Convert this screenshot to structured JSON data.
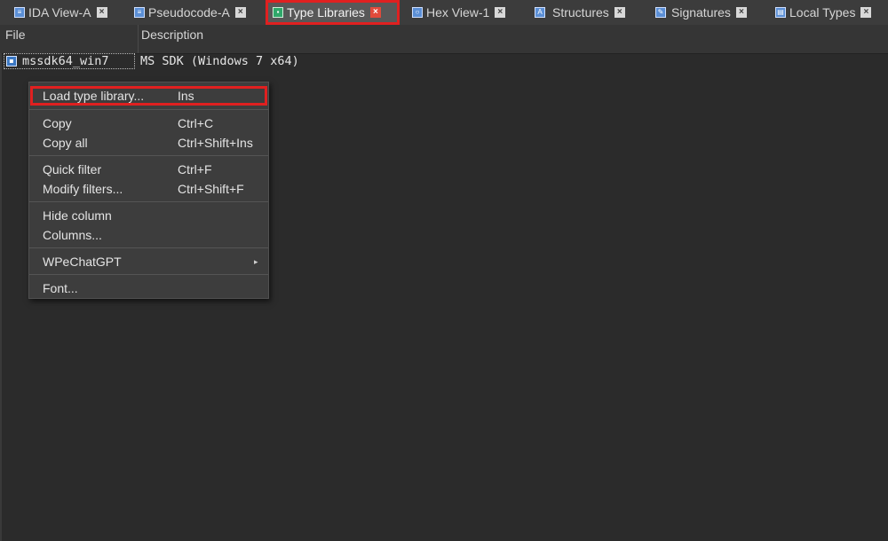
{
  "tabs": [
    {
      "label": "IDA View-A",
      "icon": "ida-view-icon"
    },
    {
      "label": "Pseudocode-A",
      "icon": "pseudocode-icon"
    },
    {
      "label": "Type Libraries",
      "icon": "type-libraries-icon",
      "active": true
    },
    {
      "label": "Hex View-1",
      "icon": "hex-view-icon"
    },
    {
      "label": "Structures",
      "icon": "structures-icon"
    },
    {
      "label": "Signatures",
      "icon": "signatures-icon"
    },
    {
      "label": "Local Types",
      "icon": "local-types-icon"
    }
  ],
  "columns": {
    "file": "File",
    "description": "Description"
  },
  "rows": [
    {
      "file": "mssdk64_win7",
      "description": "MS SDK (Windows 7 x64)"
    }
  ],
  "context_menu": {
    "items": [
      {
        "label": "Load type library...",
        "shortcut": "Ins"
      },
      {
        "label": "Copy",
        "shortcut": "Ctrl+C"
      },
      {
        "label": "Copy all",
        "shortcut": "Ctrl+Shift+Ins"
      },
      {
        "label": "Quick filter",
        "shortcut": "Ctrl+F"
      },
      {
        "label": "Modify filters...",
        "shortcut": "Ctrl+Shift+F"
      },
      {
        "label": "Hide column",
        "shortcut": ""
      },
      {
        "label": "Columns...",
        "shortcut": ""
      },
      {
        "label": "WPeChatGPT",
        "shortcut": ""
      },
      {
        "label": "Font...",
        "shortcut": ""
      }
    ],
    "submenu_arrow": "▸"
  },
  "colors": {
    "highlight": "#e02020",
    "background": "#2b2b2b"
  }
}
